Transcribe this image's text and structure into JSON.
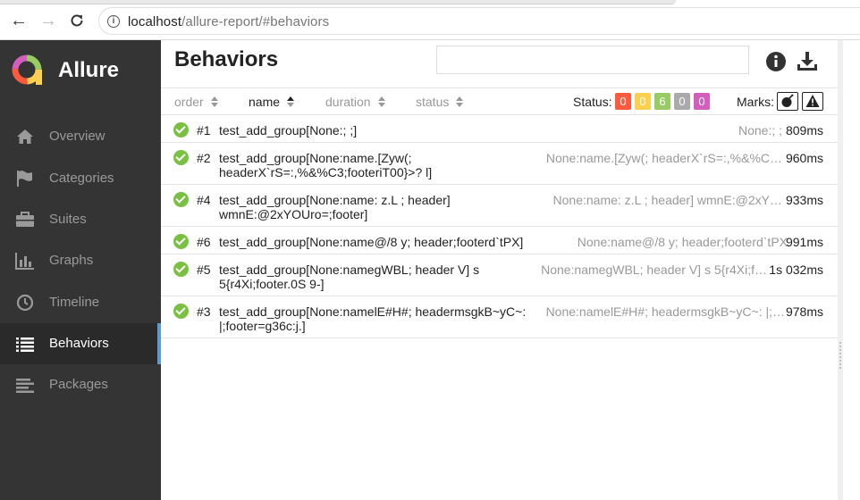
{
  "browser": {
    "url_host": "localhost",
    "url_path": "/allure-report/#behaviors"
  },
  "brand": {
    "name": "Allure"
  },
  "sidebar": {
    "items": [
      {
        "label": "Overview",
        "icon": "home-icon"
      },
      {
        "label": "Categories",
        "icon": "flag-icon"
      },
      {
        "label": "Suites",
        "icon": "briefcase-icon"
      },
      {
        "label": "Graphs",
        "icon": "bar-chart-icon"
      },
      {
        "label": "Timeline",
        "icon": "clock-icon"
      },
      {
        "label": "Behaviors",
        "icon": "list-icon",
        "active": true
      },
      {
        "label": "Packages",
        "icon": "align-left-icon"
      }
    ]
  },
  "main": {
    "title": "Behaviors",
    "search": {
      "value": "",
      "placeholder": ""
    }
  },
  "toolbar": {
    "sorters": [
      {
        "label": "order"
      },
      {
        "label": "name",
        "active": true
      },
      {
        "label": "duration"
      },
      {
        "label": "status"
      }
    ],
    "status_label": "Status:",
    "status_badges": [
      {
        "value": "0",
        "color": "#fd5a3e"
      },
      {
        "value": "0",
        "color": "#ffd050"
      },
      {
        "value": "6",
        "color": "#97cc64"
      },
      {
        "value": "0",
        "color": "#aaaaaa"
      },
      {
        "value": "0",
        "color": "#d35ebe"
      }
    ],
    "marks_label": "Marks:",
    "marks": [
      {
        "icon": "bomb-icon",
        "glyph": "💣"
      },
      {
        "icon": "warning-icon",
        "glyph": "⚠"
      }
    ]
  },
  "rows": [
    {
      "order": "#1",
      "name": "test_add_group[None:; ;]",
      "params": "None:; ;",
      "duration": "809ms"
    },
    {
      "order": "#2",
      "name": "test_add_group[None:name.[Zyw(; headerX`rS=:,%&%C3;footeriT00}>? l]",
      "params": "None:name.[Zyw(; headerX`rS=:,%&%C…",
      "duration": "960ms"
    },
    {
      "order": "#4",
      "name": "test_add_group[None:name: z.L ; header] wmnE:@2xYOUro=;footer]",
      "params": "None:name: z.L ; header] wmnE:@2xY…",
      "duration": "933ms"
    },
    {
      "order": "#6",
      "name": "test_add_group[None:name@/8 y; header;footerd`tPX]",
      "params": "None:name@/8 y; header;footerd`tPX",
      "duration": "991ms"
    },
    {
      "order": "#5",
      "name": "test_add_group[None:namegWBL; header V] s 5{r4Xi;footer.0S 9-]",
      "params": "None:namegWBL; header V] s 5{r4Xi;f…",
      "duration": "1s 032ms"
    },
    {
      "order": "#3",
      "name": "test_add_group[None:namelE#H#; headermsgkB~yC~: |;footer=g36c:j.]",
      "params": "None:namelE#H#; headermsgkB~yC~: |;…",
      "duration": "978ms"
    }
  ]
}
